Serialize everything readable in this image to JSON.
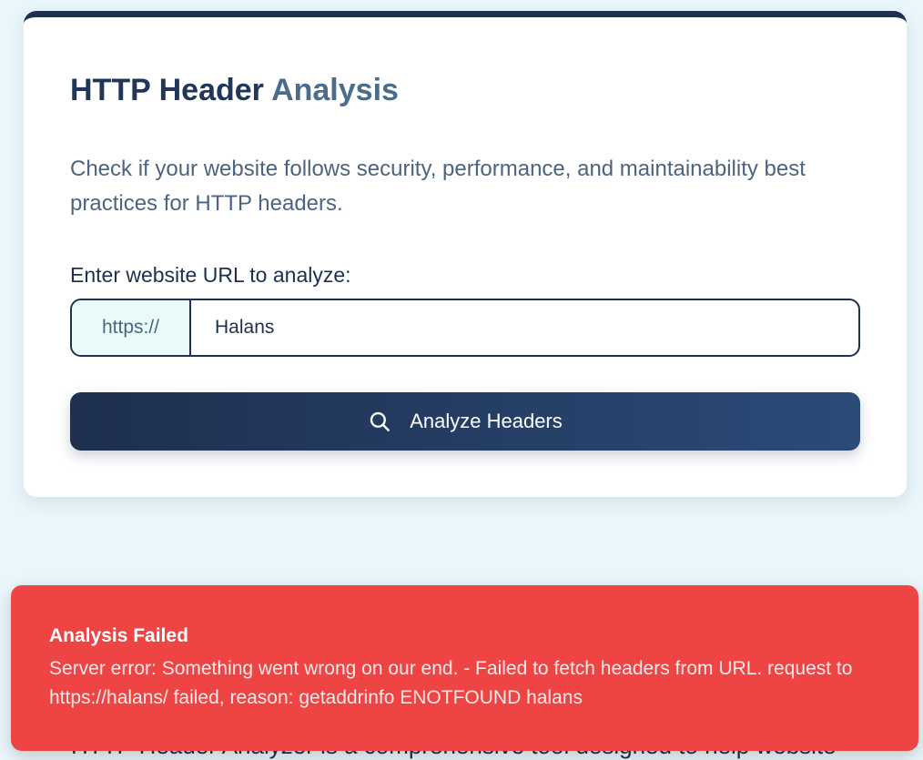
{
  "analyzer": {
    "title_main": "HTTP Header ",
    "title_accent": "Analysis",
    "description": "Check if your website follows security, performance, and maintainability best practices for HTTP headers.",
    "url_label": "Enter website URL to analyze:",
    "url_prefix": "https://",
    "url_value": "Halans",
    "button_label": "Analyze Headers",
    "search_icon": "search-icon"
  },
  "error": {
    "title": "Analysis Failed",
    "message": "Server error: Something went wrong on our end. - Failed to fetch headers from URL. request to https://halans/ failed, reason: getaddrinfo ENOTFOUND halans"
  },
  "info": {
    "text": "HTTP Header Analyzer is a comprehensive tool designed to help website"
  },
  "colors": {
    "page_background": "#e9f6fb",
    "navy": "#1e2f4f",
    "accent_blue": "#4a6d8c",
    "error_red": "#ef4444"
  }
}
